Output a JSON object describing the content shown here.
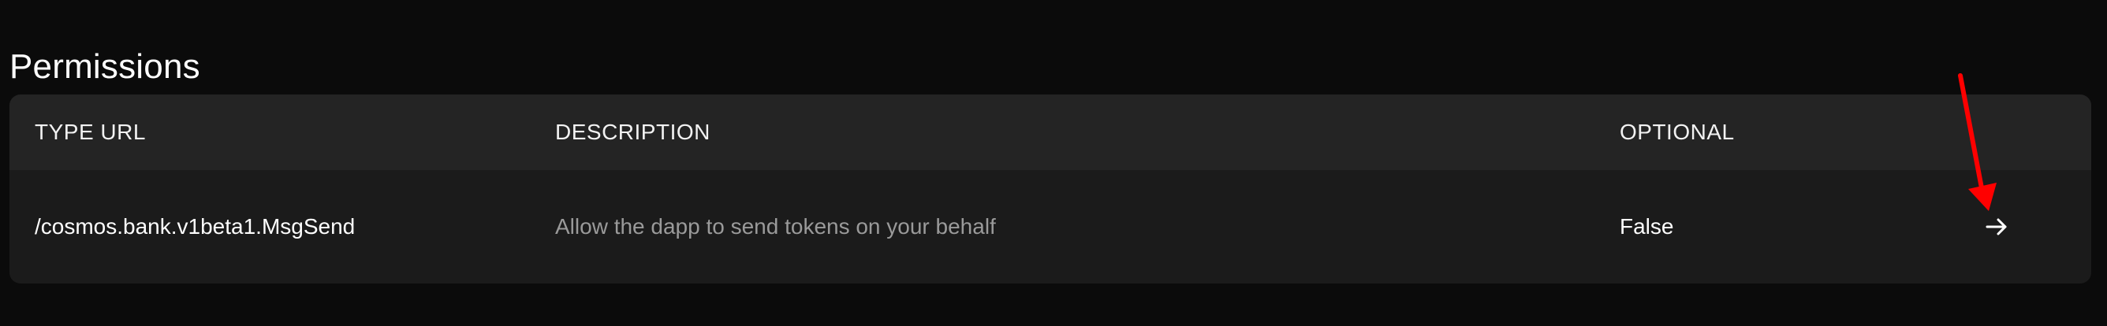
{
  "page": {
    "title": "Permissions"
  },
  "table": {
    "columns": [
      "TYPE URL",
      "DESCRIPTION",
      "OPTIONAL"
    ],
    "rows": [
      {
        "type_url": "/cosmos.bank.v1beta1.MsgSend",
        "description": "Allow the dapp to send tokens on your behalf",
        "optional": "False",
        "action_icon": "arrow-right-icon"
      }
    ]
  },
  "annotation": {
    "icon": "red-pointer-arrow-icon",
    "color": "#ff0000"
  },
  "colors": {
    "background": "#0b0b0b",
    "card": "#1b1b1b",
    "header": "#242424",
    "text_primary": "#ffffff",
    "text_secondary": "#9a9a9a"
  }
}
